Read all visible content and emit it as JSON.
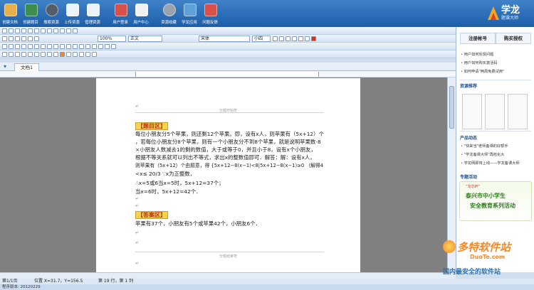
{
  "toolbar": {
    "buttons": [
      {
        "label": "创建文档",
        "icon": "create-doc-icon",
        "color": "#e8b04a"
      },
      {
        "label": "创建题目",
        "icon": "create-question-icon",
        "color": "#3c8f4e"
      },
      {
        "label": "搜索资源",
        "icon": "search-resource-icon",
        "color": "#555d68"
      },
      {
        "label": "上传资源",
        "icon": "upload-resource-icon",
        "color": "#eef3fa"
      },
      {
        "label": "管理资源",
        "icon": "manage-resource-icon",
        "color": "#eef3fa"
      },
      {
        "label": "用户登录",
        "icon": "user-login-icon",
        "color": "#d8514b"
      },
      {
        "label": "用户中心",
        "icon": "user-center-icon",
        "color": "#f2f2f2"
      },
      {
        "label": "资源收藏",
        "icon": "favorites-icon",
        "color": "#9aa3ad"
      },
      {
        "label": "学龙应用",
        "icon": "apps-icon",
        "color": "#5fa0da"
      },
      {
        "label": "问题反馈",
        "icon": "feedback-icon",
        "color": "#d8514b"
      }
    ],
    "brand_title": "学龙",
    "brand_sub": "题课大师"
  },
  "format": {
    "zoom": "100%",
    "style": "正文",
    "font": "宋体",
    "size": "小四"
  },
  "tab": {
    "label": "文档1"
  },
  "document": {
    "top_marker": "分题开始符",
    "bottom_marker": "分题结束符",
    "question_tag": "【题目区】",
    "question_lines": [
      "每位小朋友分5个苹果，则还剩12个苹果。即，设有x人，则苹果有（5x+12）个",
      "，若每位小朋友分8个苹果，则有一个小朋友分不到8个苹果，就是说明苹果数-8",
      "×小朋友人数减去1的剩的数值，大于或等于0，并且小于8，设有x个小朋友，",
      "根据不等关系就可以列出不等式，求出x的整数值即可．解答：解：设有x人，",
      "则苹果有（5x+12）个由题意，得 {5x+12−8(x−1)<8|5x+12−8(x−1)≥0 （解得4",
      "<x≤ 20/3 ∵x为正整数，",
      "∴x=5或6当x=5时，5x+12=37个；",
      "当x=6时，5x+12=42个．"
    ],
    "answer_tag": "【答案区】",
    "answer_line": "苹果有37个，小朋友有5个或苹果42个，小朋友6个．"
  },
  "right_panel": {
    "tabs": [
      "注册帐号",
      "购买授权"
    ],
    "links": [
      "用户如何反馈问题",
      "用户如何购买激活码",
      "如何申请\"两周免费试用\""
    ],
    "section_resources": "资源推荐",
    "section_news": "产品动态",
    "news": [
      "\"快来当\"老师备课的好帮手",
      "\"学龙备课大师\"再拓化大",
      "学龙网即将上线——学龙备课大师"
    ],
    "section_events": "专题活动",
    "promo_prefix": "“龙芯杯”",
    "promo_line1": "泰兴市中小学生",
    "promo_line2": "安全教育系列活动"
  },
  "status": {
    "page": "第1/1页",
    "position": "位置 X=31.7，Y=156.5",
    "line": "第 19 行，第 1 列"
  },
  "footer": {
    "version": "程序版本: 20120229"
  },
  "watermark": {
    "name": "多特软件站",
    "domain": "DuoTe.com",
    "slogan": "国内最安全的软件站"
  }
}
